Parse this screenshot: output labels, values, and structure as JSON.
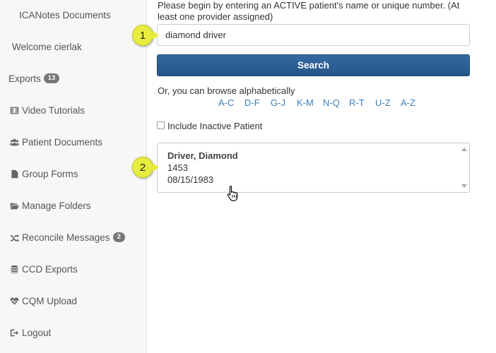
{
  "sidebar": {
    "items": [
      {
        "label": "ICANotes Documents",
        "icon": "",
        "badge": ""
      },
      {
        "label": "Welcome cierlak",
        "icon": "",
        "badge": ""
      },
      {
        "label": "Exports",
        "icon": "",
        "badge": "13"
      },
      {
        "label": "Video Tutorials",
        "icon": "film-icon",
        "badge": ""
      },
      {
        "label": "Patient Documents",
        "icon": "users-icon",
        "badge": ""
      },
      {
        "label": "Group Forms",
        "icon": "file-icon",
        "badge": ""
      },
      {
        "label": "Manage Folders",
        "icon": "folder-open-icon",
        "badge": ""
      },
      {
        "label": "Reconcile Messages",
        "icon": "shuffle-icon",
        "badge": "2"
      },
      {
        "label": "CCD Exports",
        "icon": "database-icon",
        "badge": ""
      },
      {
        "label": "CQM Upload",
        "icon": "heartbeat-icon",
        "badge": ""
      },
      {
        "label": "Logout",
        "icon": "sign-out-icon",
        "badge": ""
      }
    ]
  },
  "main": {
    "intro_text": "Please begin by entering an ACTIVE patient's name or unique number. (At least one provider assigned)",
    "search": {
      "value": "diamond driver",
      "button_label": "Search"
    },
    "browse": {
      "text": "Or, you can browse alphabetically",
      "ranges": [
        "A-C",
        "D-F",
        "G-J",
        "K-M",
        "N-Q",
        "R-T",
        "U-Z",
        "A-Z"
      ]
    },
    "include_inactive_label": "Include Inactive Patient",
    "result": {
      "name": "Driver, Diamond",
      "number": "1453",
      "dob": "08/15/1983"
    }
  },
  "callouts": {
    "first": "1",
    "second": "2"
  },
  "colors": {
    "button": "#2a5f92",
    "link": "#3c7fb8",
    "callout": "#e7ec3f",
    "badge": "#777777"
  }
}
